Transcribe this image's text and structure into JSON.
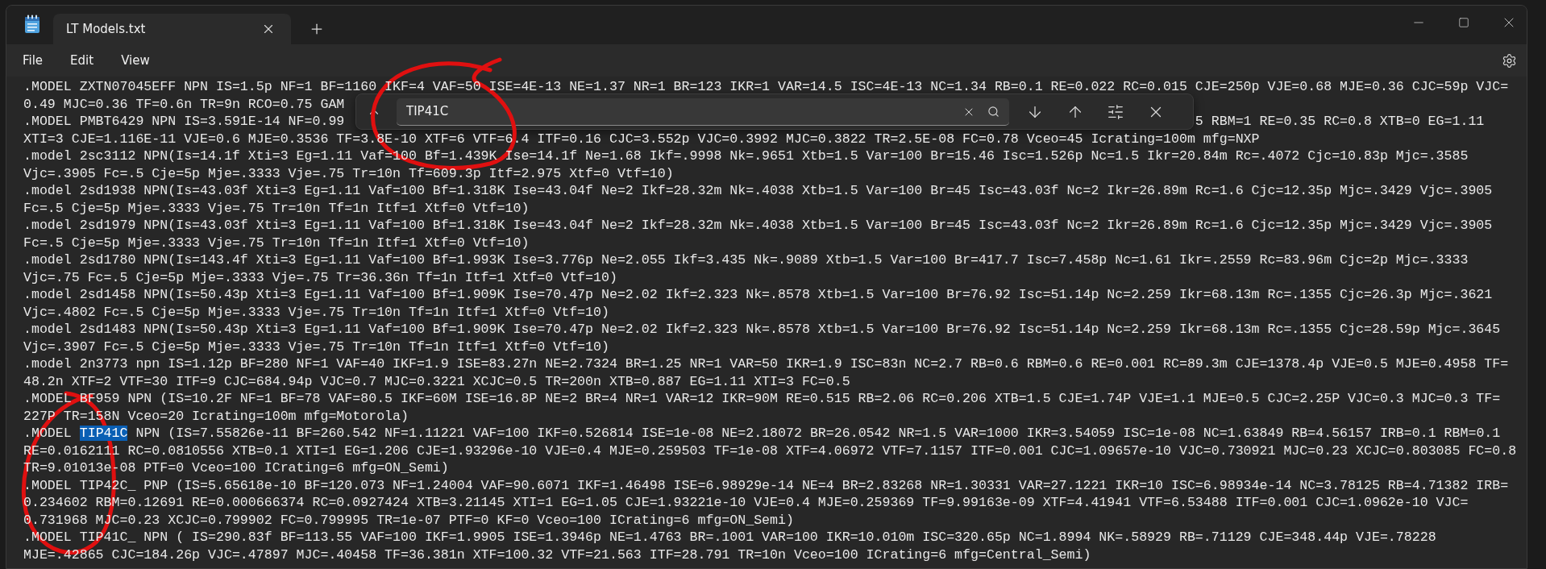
{
  "window": {
    "tab_title": "LT Models.txt"
  },
  "menu": [
    "File",
    "Edit",
    "View"
  ],
  "find": {
    "value": "TIP41C"
  },
  "lines": [
    {
      "kind": "plain",
      "text": ".MODEL ZXTN07045EFF NPN IS=1.5p NF=1 BF=1160 IKF=4 VAF=50 ISE=4E-13 NE=1.37 NR=1 BR=123 IKR=1 VAR=14.5 ISC=4E-13 NC=1.34 RB=0.1 RE=0.022 RC=0.015 CJE=250p VJE=0.68 MJE=0.36 CJC=59p VJC="
    },
    {
      "kind": "split",
      "left": "0.49 MJC=0.36 TF=0.6n TR=9n RCO=0.75 GAM"
    },
    {
      "kind": "split",
      "left": ".MODEL PMBT6429 NPN IS=3.591E-14 NF=0.99",
      "right": "5 RBM=1 RE=0.35 RC=0.8 XTB=0 EG=1.11"
    },
    {
      "kind": "plain",
      "text": "XTI=3 CJE=1.116E-11 VJE=0.6 MJE=0.3536 TF=3.8E-10 XTF=6 VTF=6.4 ITF=0.16 CJC=3.552p VJC=0.3992 MJC=0.3822 TR=2.5E-08 FC=0.78 Vceo=45 Icrating=100m mfg=NXP"
    },
    {
      "kind": "plain",
      "text": ".model 2sc3112 NPN(Is=14.1f Xti=3 Eg=1.11 Vaf=100 Bf=1.439K Ise=14.1f Ne=1.68 Ikf=.9998 Nk=.9651 Xtb=1.5 Var=100 Br=15.46 Isc=1.526p Nc=1.5 Ikr=20.84m Rc=.4072 Cjc=10.83p Mjc=.3585"
    },
    {
      "kind": "plain",
      "text": "Vjc=.3905 Fc=.5 Cje=5p Mje=.3333 Vje=.75 Tr=10n Tf=609.3p Itf=2.975 Xtf=0 Vtf=10)"
    },
    {
      "kind": "plain",
      "text": ".model 2sd1938 NPN(Is=43.03f Xti=3 Eg=1.11 Vaf=100 Bf=1.318K Ise=43.04f Ne=2 Ikf=28.32m Nk=.4038 Xtb=1.5 Var=100 Br=45 Isc=43.03f Nc=2 Ikr=26.89m Rc=1.6 Cjc=12.35p Mjc=.3429 Vjc=.3905"
    },
    {
      "kind": "plain",
      "text": "Fc=.5 Cje=5p Mje=.3333 Vje=.75 Tr=10n Tf=1n Itf=1 Xtf=0 Vtf=10)"
    },
    {
      "kind": "plain",
      "text": ".model 2sd1979 NPN(Is=43.03f Xti=3 Eg=1.11 Vaf=100 Bf=1.318K Ise=43.04f Ne=2 Ikf=28.32m Nk=.4038 Xtb=1.5 Var=100 Br=45 Isc=43.03f Nc=2 Ikr=26.89m Rc=1.6 Cjc=12.35p Mjc=.3429 Vjc=.3905"
    },
    {
      "kind": "plain",
      "text": "Fc=.5 Cje=5p Mje=.3333 Vje=.75 Tr=10n Tf=1n Itf=1 Xtf=0 Vtf=10)"
    },
    {
      "kind": "plain",
      "text": ".model 2sd1780 NPN(Is=143.4f Xti=3 Eg=1.11 Vaf=100 Bf=1.993K Ise=3.776p Ne=2.055 Ikf=3.435 Nk=.9089 Xtb=1.5 Var=100 Br=417.7 Isc=7.458p Nc=1.61 Ikr=.2559 Rc=83.96m Cjc=2p Mjc=.3333"
    },
    {
      "kind": "plain",
      "text": "Vjc=.75 Fc=.5 Cje=5p Mje=.3333 Vje=.75 Tr=36.36n Tf=1n Itf=1 Xtf=0 Vtf=10)"
    },
    {
      "kind": "plain",
      "text": ".model 2sd1458 NPN(Is=50.43p Xti=3 Eg=1.11 Vaf=100 Bf=1.909K Ise=70.47p Ne=2.02 Ikf=2.323 Nk=.8578 Xtb=1.5 Var=100 Br=76.92 Isc=51.14p Nc=2.259 Ikr=68.13m Rc=.1355 Cjc=26.3p Mjc=.3621"
    },
    {
      "kind": "plain",
      "text": "Vjc=.4802 Fc=.5 Cje=5p Mje=.3333 Vje=.75 Tr=10n Tf=1n Itf=1 Xtf=0 Vtf=10)"
    },
    {
      "kind": "plain",
      "text": ".model 2sd1483 NPN(Is=50.43p Xti=3 Eg=1.11 Vaf=100 Bf=1.909K Ise=70.47p Ne=2.02 Ikf=2.323 Nk=.8578 Xtb=1.5 Var=100 Br=76.92 Isc=51.14p Nc=2.259 Ikr=68.13m Rc=.1355 Cjc=28.59p Mjc=.3645"
    },
    {
      "kind": "plain",
      "text": "Vjc=.3907 Fc=.5 Cje=5p Mje=.3333 Vje=.75 Tr=10n Tf=1n Itf=1 Xtf=0 Vtf=10)"
    },
    {
      "kind": "plain",
      "text": ".model 2n3773 npn IS=1.12p BF=280 NF=1 VAF=40 IKF=1.9 ISE=83.27n NE=2.7324 BR=1.25 NR=1 VAR=50 IKR=1.9 ISC=83n NC=2.7 RB=0.6 RBM=0.6 RE=0.001 RC=89.3m CJE=1378.4p VJE=0.5 MJE=0.4958 TF="
    },
    {
      "kind": "plain",
      "text": "48.2n XTF=2 VTF=30 ITF=9 CJC=684.94p VJC=0.7 MJC=0.3221 XCJC=0.5 TR=200n XTB=0.887 EG=1.11 XTI=3 FC=0.5"
    },
    {
      "kind": "plain",
      "text": ".MODEL BF959 NPN (IS=10.2F NF=1 BF=78 VAF=80.5 IKF=60M ISE=16.8P NE=2 BR=4 NR=1 VAR=12 IKR=90M RE=0.515 RB=2.06 RC=0.206 XTB=1.5 CJE=1.74P VJE=1.1 MJE=0.5 CJC=2.25P VJC=0.3 MJC=0.3 TF="
    },
    {
      "kind": "plain",
      "text": "227P TR=158N Vceo=20 Icrating=100m mfg=Motorola)"
    },
    {
      "kind": "match",
      "parts": [
        {
          "text": ".MODEL ",
          "highlighted": false
        },
        {
          "text": "TIP41C",
          "highlighted": true
        },
        {
          "text": " NPN (IS=7.55826e-11 BF=260.542 NF=1.11221 VAF=100 IKF=0.526814 ISE=1e-08 NE=2.18072 BR=26.0542 NR=1.5 VAR=1000 IKR=3.54059 ISC=1e-08 NC=1.63849 RB=4.56157 IRB=0.1 RBM=0.1",
          "highlighted": false
        }
      ]
    },
    {
      "kind": "plain",
      "text": "RE=0.0162111 RC=0.0810556 XTB=0.1 XTI=1 EG=1.206 CJE=1.93296e-10 VJE=0.4 MJE=0.259503 TF=1e-08 XTF=4.06972 VTF=7.1157 ITF=0.001 CJC=1.09657e-10 VJC=0.730921 MJC=0.23 XCJC=0.803085 FC=0.8"
    },
    {
      "kind": "plain",
      "text": "TR=9.01013e-08 PTF=0 Vceo=100 ICrating=6 mfg=ON_Semi)"
    },
    {
      "kind": "plain",
      "text": ".MODEL TIP42C_ PNP (IS=5.65618e-10 BF=120.073 NF=1.24004 VAF=90.6071 IKF=1.46498 ISE=6.98929e-14 NE=4 BR=2.83268 NR=1.30331 VAR=27.1221 IKR=10 ISC=6.98934e-14 NC=3.78125 RB=4.71382 IRB="
    },
    {
      "kind": "plain",
      "text": "0.234602 RBM=0.12691 RE=0.000666374 RC=0.0927424 XTB=3.21145 XTI=1 EG=1.05 CJE=1.93221e-10 VJE=0.4 MJE=0.259369 TF=9.99163e-09 XTF=4.41941 VTF=6.53488 ITF=0.001 CJC=1.0962e-10 VJC="
    },
    {
      "kind": "plain",
      "text": "0.731968 MJC=0.23 XCJC=0.799902 FC=0.799995 TR=1e-07 PTF=0 KF=0 Vceo=100 ICrating=6 mfg=ON_Semi)"
    },
    {
      "kind": "plain",
      "text": ".MODEL TIP41C_ NPN ( IS=290.83f BF=113.55 VAF=100 IKF=1.9905 ISE=1.3946p NE=1.4763 BR=.1001 VAR=100 IKR=10.010m ISC=320.65p NC=1.8994 NK=.58929 RB=.71129 CJE=348.44p VJE=.78228"
    },
    {
      "kind": "plain",
      "text": "MJE=.42865 CJC=184.26p VJC=.47897 MJC=.40458 TF=36.381n XTF=100.32 VTF=21.563 ITF=28.791 TR=10n Vceo=100 ICrating=6 mfg=Central_Semi)"
    }
  ]
}
